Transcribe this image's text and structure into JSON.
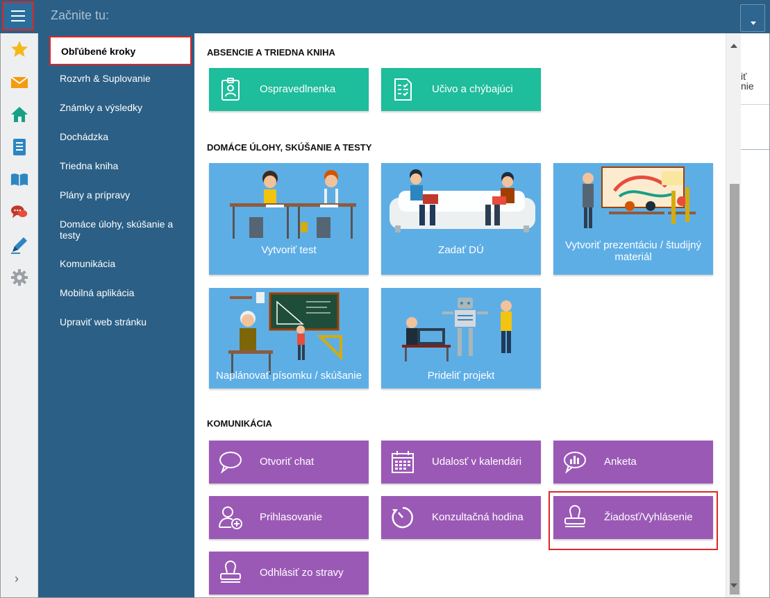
{
  "topbar": {
    "title": "Začnite tu:"
  },
  "nav": {
    "items": [
      "Obľúbené kroky",
      "Rozvrh & Suplovanie",
      "Známky a výsledky",
      "Dochádzka",
      "Triedna kniha",
      "Plány a prípravy",
      "Domáce úlohy, skúšanie a testy",
      "Komunikácia",
      "Mobilná aplikácia",
      "Upraviť web stránku"
    ]
  },
  "sections": [
    {
      "title": "ABSENCIE A TRIEDNA KNIHA",
      "tiles": [
        "Ospravedlnenka",
        "Učivo a chýbajúci"
      ]
    },
    {
      "title": "DOMÁCE ÚLOHY, SKÚŠANIE A TESTY",
      "tiles": [
        "Vytvoriť test",
        "Zadať DÚ",
        "Vytvoriť prezentáciu / študijný materiál",
        "Naplánovať písomku / skúšanie",
        "Prideliť projekt"
      ]
    },
    {
      "title": "KOMUNIKÁCIA",
      "tiles": [
        "Otvoriť chat",
        "Udalosť v kalendári",
        "Anketa",
        "Prihlasovanie",
        "Konzultačná hodina",
        "Žiadosť/Vyhlásenie",
        "Odhlásiť zo stravy"
      ]
    }
  ],
  "background_page": {
    "text_line1": "iť",
    "text_line2": "nie"
  },
  "colors": {
    "header": "#2b5f85",
    "green_tile": "#1ebd9b",
    "purple_tile": "#9b59b6",
    "blue_tile": "#5eaee6",
    "highlight": "#e02424"
  }
}
